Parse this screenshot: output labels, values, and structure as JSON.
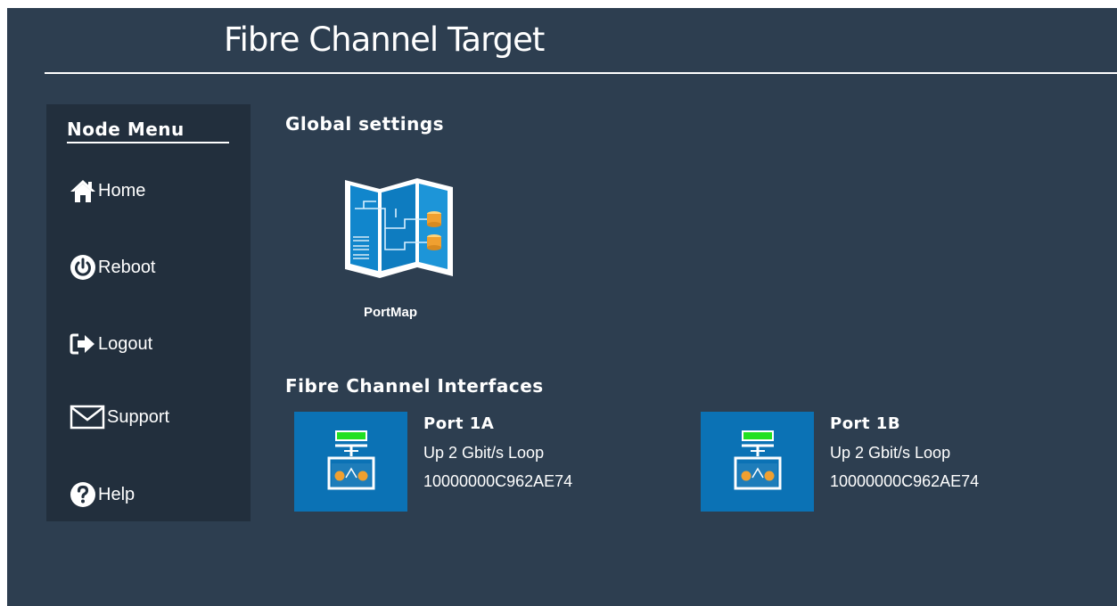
{
  "page": {
    "title": "Fibre Channel Target"
  },
  "sidebar": {
    "heading": "Node Menu",
    "items": [
      {
        "label": "Home",
        "icon": "home-icon"
      },
      {
        "label": "Reboot",
        "icon": "power-icon"
      },
      {
        "label": "Logout",
        "icon": "logout-icon"
      },
      {
        "label": "Support",
        "icon": "envelope-icon"
      },
      {
        "label": "Help",
        "icon": "question-icon"
      }
    ]
  },
  "global_settings": {
    "heading": "Global settings",
    "apps": [
      {
        "label": "PortMap",
        "icon": "portmap-icon"
      }
    ]
  },
  "interfaces": {
    "heading": "Fibre Channel Interfaces",
    "ports": [
      {
        "name": "Port 1A",
        "status": "Up 2 Gbit/s Loop",
        "wwn": "10000000C962AE74",
        "icon": "port-icon"
      },
      {
        "name": "Port 1B",
        "status": "Up 2 Gbit/s Loop",
        "wwn": "10000000C962AE74",
        "icon": "port-icon"
      }
    ]
  },
  "colors": {
    "background": "#2d3e50",
    "sidebar": "#222f3d",
    "tile": "#0b72b5",
    "link_led": "#22e022",
    "connector": "#f0a030"
  }
}
